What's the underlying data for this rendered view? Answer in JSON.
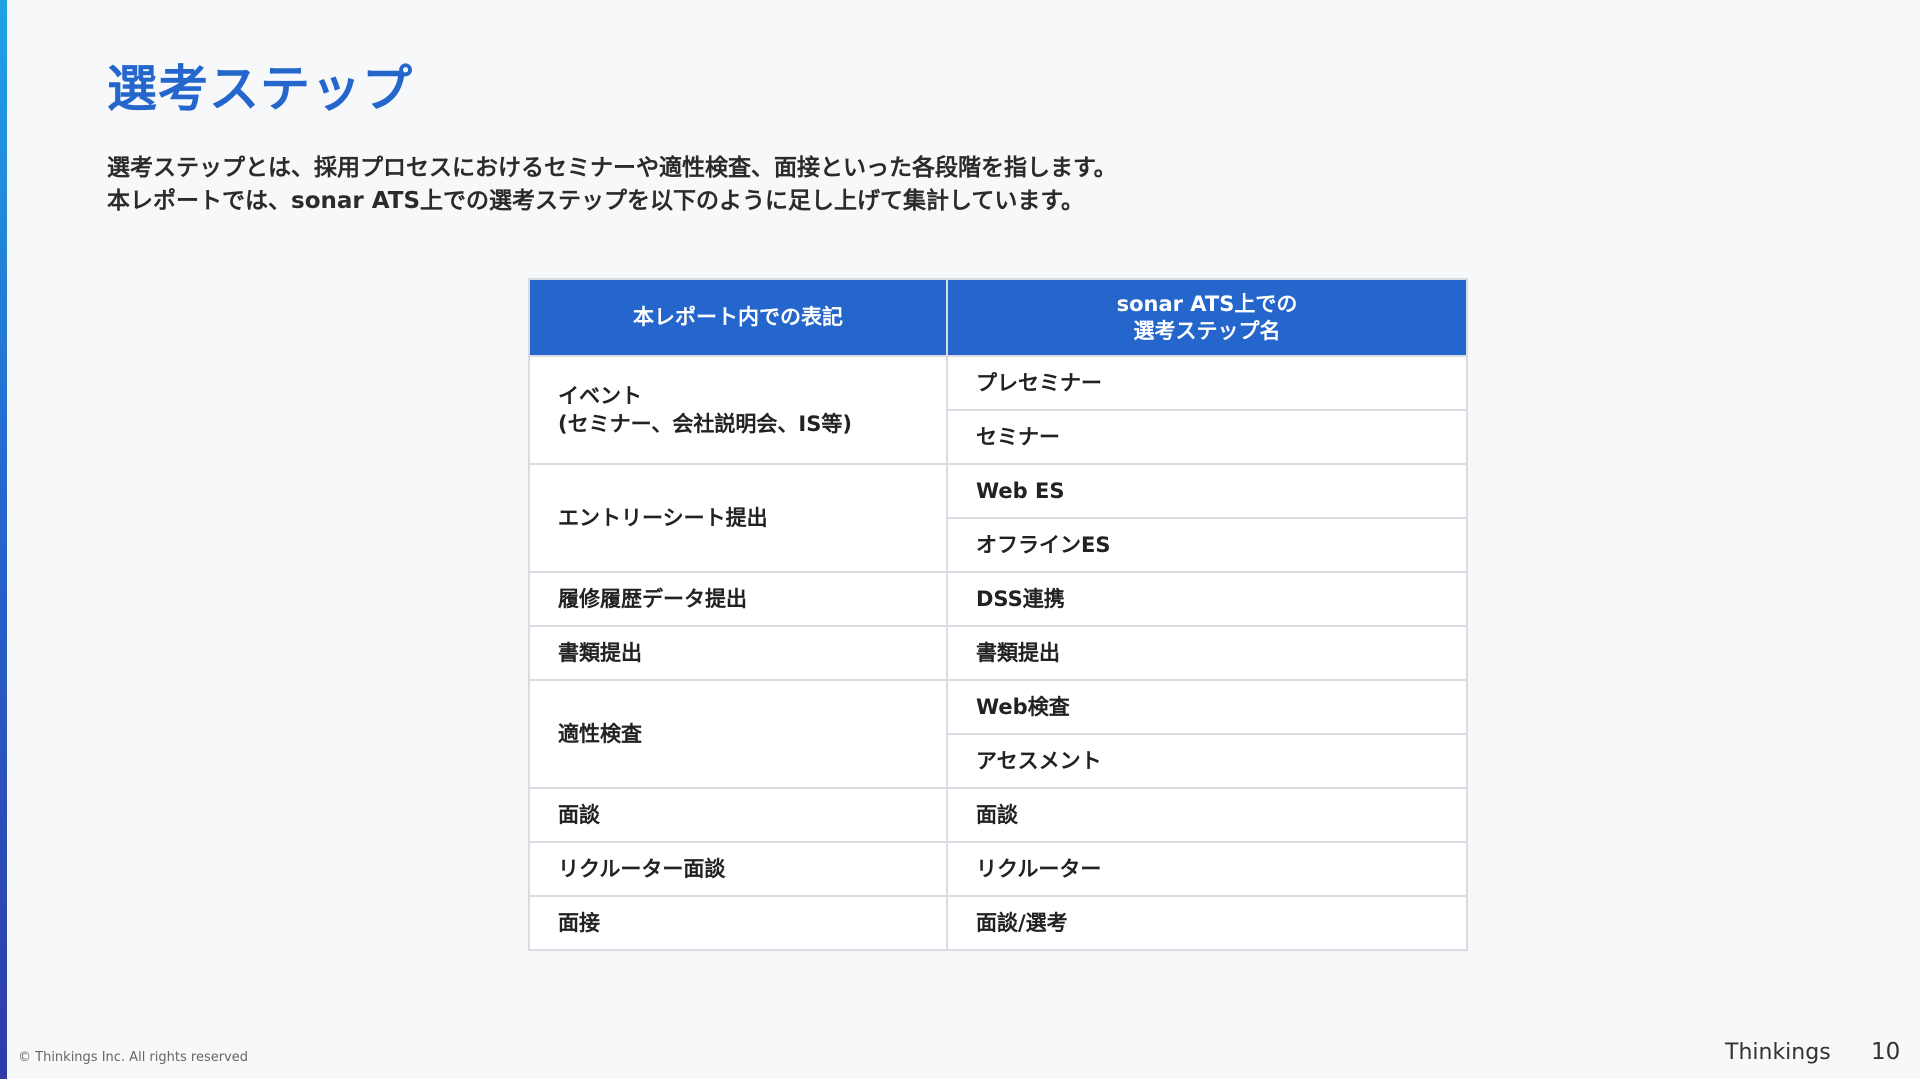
{
  "page": {
    "title": "選考ステップ",
    "intro_line1": "選考ステップとは、採用プロセスにおけるセミナーや適性検査、面接といった各段階を指します。",
    "intro_line2": "本レポートでは、sonar ATS上での選考ステップを以下のように足し上げて集計しています。"
  },
  "table": {
    "header_col1": "本レポート内での表記",
    "header_col2_line1": "sonar ATS上での",
    "header_col2_line2": "選考ステップ名",
    "groups": [
      {
        "label_line1": "イベント",
        "label_line2": "(セミナー、会社説明会、IS等)",
        "items": [
          "プレセミナー",
          "セミナー"
        ]
      },
      {
        "label_line1": "エントリーシート提出",
        "items": [
          "Web ES",
          "オフラインES"
        ]
      },
      {
        "label_line1": "履修履歴データ提出",
        "items": [
          "DSS連携"
        ]
      },
      {
        "label_line1": "書類提出",
        "items": [
          "書類提出"
        ]
      },
      {
        "label_line1": "適性検査",
        "items": [
          "Web検査",
          "アセスメント"
        ]
      },
      {
        "label_line1": "面談",
        "items": [
          "面談"
        ]
      },
      {
        "label_line1": "リクルーター面談",
        "items": [
          "リクルーター"
        ]
      },
      {
        "label_line1": "面接",
        "items": [
          "面談/選考"
        ]
      }
    ]
  },
  "footer": {
    "copyright": "© Thinkings Inc. All rights reserved",
    "brand": "Thinkings",
    "page_number": "10"
  },
  "colors": {
    "accent": "#2466cc",
    "background": "#f6f8fa",
    "table_border": "#d9dde3"
  }
}
